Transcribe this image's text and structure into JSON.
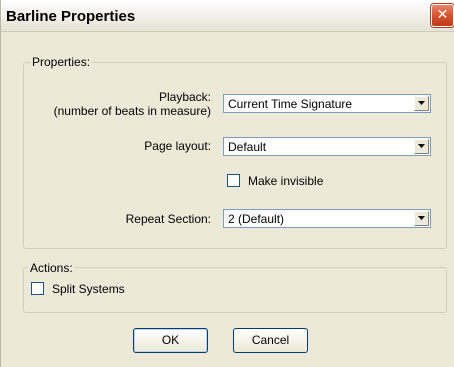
{
  "window": {
    "title": "Barline Properties",
    "close_glyph": "✕"
  },
  "properties_group": {
    "legend": "Properties:",
    "playback": {
      "label_line1": "Playback:",
      "label_line2": "(number of beats in measure)",
      "value": "Current Time Signature"
    },
    "page_layout": {
      "label": "Page layout:",
      "value": "Default"
    },
    "make_invisible": {
      "label": "Make invisible",
      "checked": false
    },
    "repeat_section": {
      "label": "Repeat Section:",
      "value": "2 (Default)"
    }
  },
  "actions_group": {
    "legend": "Actions:",
    "split_systems": {
      "label": "Split Systems",
      "checked": false
    }
  },
  "buttons": {
    "ok": "OK",
    "cancel": "Cancel"
  },
  "icons": {
    "close": "close-icon",
    "dropdown": "chevron-down-icon"
  }
}
